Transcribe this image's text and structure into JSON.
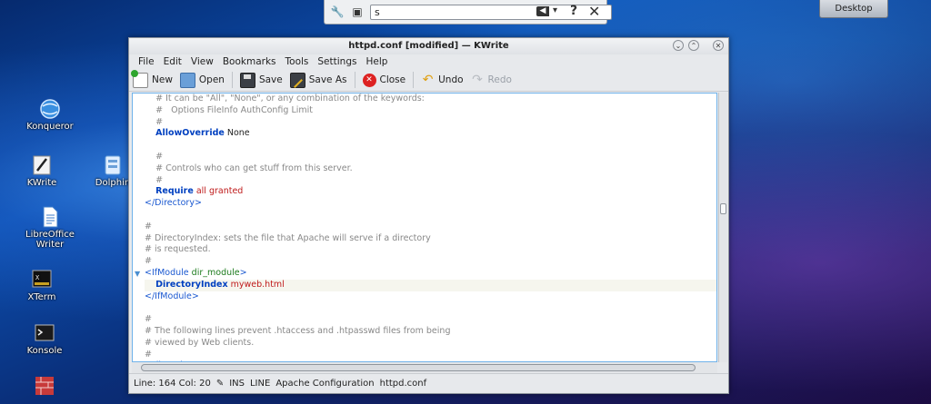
{
  "find_bar": {
    "query": "s",
    "clear_glyph": "◀",
    "dropdown_glyph": "▾",
    "help_glyph": "?",
    "close_glyph": "✕"
  },
  "desktop_button": "Desktop",
  "desktop_icons": [
    {
      "label": "Konqueror",
      "icon": "globe-icon"
    },
    {
      "label": "KWrite",
      "icon": "pen-icon"
    },
    {
      "label": "Dolphin",
      "icon": "folder-icon"
    },
    {
      "label": "LibreOffice Writer",
      "icon": "document-icon"
    },
    {
      "label": "XTerm",
      "icon": "terminal-icon"
    },
    {
      "label": "Konsole",
      "icon": "console-icon"
    }
  ],
  "window": {
    "title": "httpd.conf  [modified]  — KWrite",
    "menu": [
      "File",
      "Edit",
      "View",
      "Bookmarks",
      "Tools",
      "Settings",
      "Help"
    ],
    "toolbar": {
      "new": "New",
      "open": "Open",
      "save": "Save",
      "save_as": "Save As",
      "close": "Close",
      "undo": "Undo",
      "redo": "Redo"
    },
    "editor_lines": [
      {
        "indent": "    ",
        "parts": [
          {
            "t": "# It can be \"All\", \"None\", or any combination of the keywords:",
            "c": "cmt"
          }
        ]
      },
      {
        "indent": "    ",
        "parts": [
          {
            "t": "#   Options FileInfo AuthConfig Limit",
            "c": "cmt"
          }
        ]
      },
      {
        "indent": "    ",
        "parts": [
          {
            "t": "#",
            "c": "cmt"
          }
        ]
      },
      {
        "indent": "    ",
        "parts": [
          {
            "t": "AllowOverride",
            "c": "kw"
          },
          {
            "t": " None",
            "c": "val"
          }
        ]
      },
      {
        "indent": "",
        "parts": []
      },
      {
        "indent": "    ",
        "parts": [
          {
            "t": "#",
            "c": "cmt"
          }
        ]
      },
      {
        "indent": "    ",
        "parts": [
          {
            "t": "# Controls who can get stuff from this server.",
            "c": "cmt"
          }
        ]
      },
      {
        "indent": "    ",
        "parts": [
          {
            "t": "#",
            "c": "cmt"
          }
        ]
      },
      {
        "indent": "    ",
        "parts": [
          {
            "t": "Require",
            "c": "kw"
          },
          {
            "t": " all granted",
            "c": "str"
          }
        ]
      },
      {
        "indent": "",
        "parts": [
          {
            "t": "</Directory>",
            "c": "tag"
          }
        ]
      },
      {
        "indent": "",
        "parts": []
      },
      {
        "indent": "",
        "parts": [
          {
            "t": "#",
            "c": "cmt"
          }
        ]
      },
      {
        "indent": "",
        "parts": [
          {
            "t": "# DirectoryIndex: sets the file that Apache will serve if a directory",
            "c": "cmt"
          }
        ]
      },
      {
        "indent": "",
        "parts": [
          {
            "t": "# is requested.",
            "c": "cmt"
          }
        ]
      },
      {
        "indent": "",
        "parts": [
          {
            "t": "#",
            "c": "cmt"
          }
        ]
      },
      {
        "indent": "",
        "parts": [
          {
            "t": "<IfModule ",
            "c": "tag"
          },
          {
            "t": "dir_module",
            "c": "grn"
          },
          {
            "t": ">",
            "c": "tag"
          }
        ],
        "fold": true
      },
      {
        "indent": "    ",
        "parts": [
          {
            "t": "DirectoryIndex",
            "c": "kw"
          },
          {
            "t": " myweb.html",
            "c": "str"
          }
        ],
        "current": true
      },
      {
        "indent": "",
        "parts": [
          {
            "t": "</IfModule>",
            "c": "tag"
          }
        ]
      },
      {
        "indent": "",
        "parts": []
      },
      {
        "indent": "",
        "parts": [
          {
            "t": "#",
            "c": "cmt"
          }
        ]
      },
      {
        "indent": "",
        "parts": [
          {
            "t": "# The following lines prevent .htaccess and .htpasswd files from being",
            "c": "cmt"
          }
        ]
      },
      {
        "indent": "",
        "parts": [
          {
            "t": "# viewed by Web clients.",
            "c": "cmt"
          }
        ]
      },
      {
        "indent": "",
        "parts": [
          {
            "t": "#",
            "c": "cmt"
          }
        ]
      },
      {
        "indent": "",
        "parts": [
          {
            "t": "<Files \".ht*\">",
            "c": "tag"
          }
        ]
      }
    ],
    "status": {
      "position": "Line: 164 Col: 20",
      "mode": "INS",
      "select_mode": "LINE",
      "file_type": "Apache Configuration",
      "file_name": "httpd.conf"
    }
  }
}
